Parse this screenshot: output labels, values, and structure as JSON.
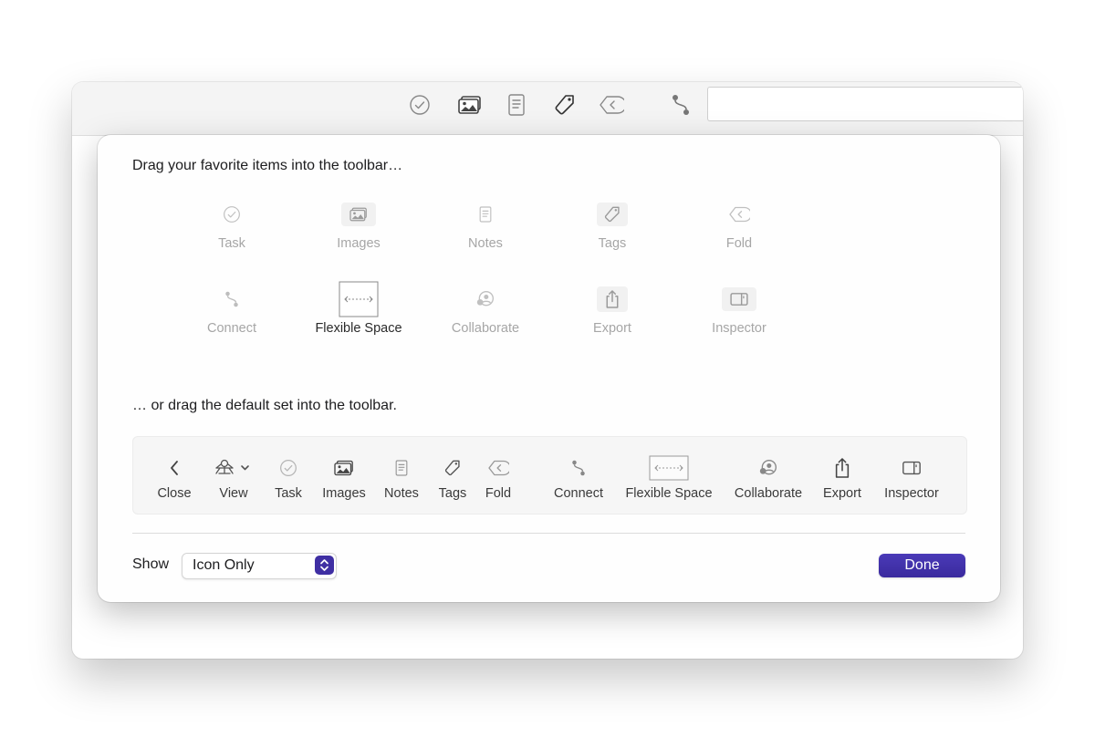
{
  "colors": {
    "accent": "#3f2fa3",
    "icon_dim": "#b9b9b9",
    "icon_dark": "#555555"
  },
  "toolbar": {
    "icons": [
      "task-icon",
      "images-icon",
      "notes-icon",
      "tags-icon",
      "fold-icon",
      "connect-icon"
    ],
    "search": {
      "value": ""
    }
  },
  "sheet": {
    "favorites_heading": "Drag your favorite items into the toolbar…",
    "favorites": [
      {
        "label": "Task",
        "icon": "task-icon"
      },
      {
        "label": "Images",
        "icon": "images-icon"
      },
      {
        "label": "Notes",
        "icon": "notes-icon"
      },
      {
        "label": "Tags",
        "icon": "tags-icon"
      },
      {
        "label": "Fold",
        "icon": "fold-icon"
      },
      {
        "label": "Connect",
        "icon": "connect-icon"
      },
      {
        "label": "Flexible Space",
        "icon": "flexible-space-icon"
      },
      {
        "label": "Collaborate",
        "icon": "collaborate-icon"
      },
      {
        "label": "Export",
        "icon": "export-icon"
      },
      {
        "label": "Inspector",
        "icon": "inspector-icon"
      }
    ],
    "default_heading": "… or drag the default set into the toolbar.",
    "default_set": [
      {
        "label": "Close",
        "icon": "chevron-left-icon"
      },
      {
        "label": "View",
        "icon": "view-icon"
      },
      {
        "label": "Task",
        "icon": "task-icon"
      },
      {
        "label": "Images",
        "icon": "images-icon"
      },
      {
        "label": "Notes",
        "icon": "notes-icon"
      },
      {
        "label": "Tags",
        "icon": "tags-icon"
      },
      {
        "label": "Fold",
        "icon": "fold-icon"
      },
      {
        "label": "Connect",
        "icon": "connect-icon"
      },
      {
        "label": "Flexible Space",
        "icon": "flexible-space-icon"
      },
      {
        "label": "Collaborate",
        "icon": "collaborate-icon"
      },
      {
        "label": "Export",
        "icon": "export-icon"
      },
      {
        "label": "Inspector",
        "icon": "inspector-icon"
      }
    ],
    "show_label": "Show",
    "show_select": {
      "value": "Icon Only"
    },
    "done_label": "Done"
  }
}
